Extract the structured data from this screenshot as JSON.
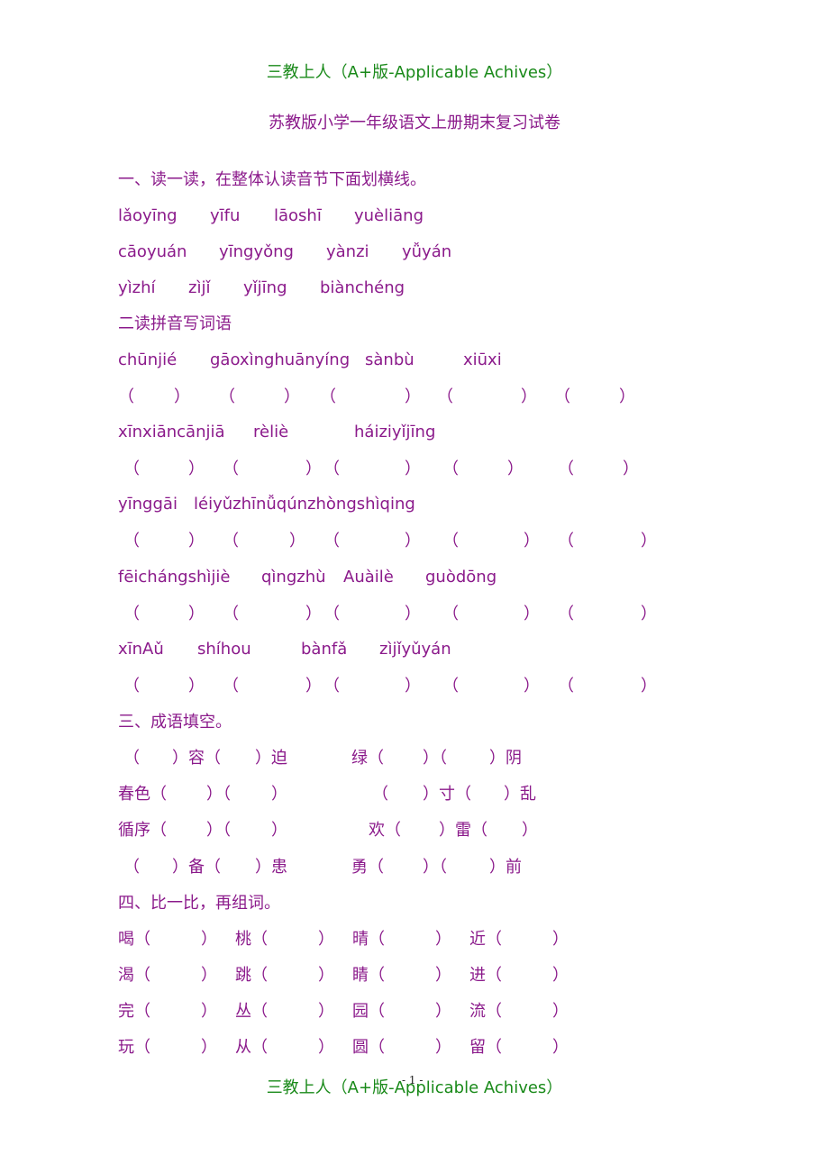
{
  "header": "三教上人（A+版-Applicable Achives）",
  "title": "苏教版小学一年级语文上册期末复习试卷",
  "section1": {
    "heading": "一、读一读，在整体认读音节下面划横线。",
    "rows": [
      [
        "lǎoyīng",
        "yīfu",
        "lāoshī",
        "yuèliāng"
      ],
      [
        "cāoyuán",
        "yīngyǒng",
        "yànzi",
        "yǚyán"
      ],
      [
        "yìzhí",
        "zìjǐ",
        "yǐjīng",
        "biànchéng"
      ]
    ]
  },
  "section2": {
    "heading": "二读拼音写词语",
    "pinyin_rows": [
      [
        "chūnjié",
        "gāoxìnghuānyíng",
        "sànbù",
        "xiūxi"
      ],
      [
        "xīnxiāncānjiā",
        "rèliè",
        "háiziyǐjīng"
      ],
      [
        "yīnggāi",
        "léiyǔzhīnǚqúnzhòngshìqing"
      ],
      [
        "fēichángshìjiè",
        "qìngzhù",
        "Auàilè",
        "guòdōng"
      ],
      [
        "xīnAǔ",
        "shíhou",
        "bànfǎ",
        "zìjǐyǔyán"
      ]
    ],
    "blank_open": "（",
    "blank_close": "）"
  },
  "section3": {
    "heading": "三、成语填空。",
    "rows": [
      [
        [
          "（",
          "）容（",
          "）迫"
        ],
        [
          "绿（",
          "）（",
          "）阴"
        ]
      ],
      [
        [
          "春色（",
          "）（",
          "）"
        ],
        [
          "（",
          "）寸（",
          "）乱"
        ]
      ],
      [
        [
          "循序（",
          "）（",
          "）"
        ],
        [
          "欢（",
          "）雷（",
          "）"
        ]
      ],
      [
        [
          "（",
          "）备（",
          "）患"
        ],
        [
          "勇（",
          "）（",
          "）前"
        ]
      ]
    ]
  },
  "section4": {
    "heading": "四、比一比，再组词。",
    "rows": [
      [
        "喝",
        "桃",
        "晴",
        "近"
      ],
      [
        "渴",
        "跳",
        "睛",
        "进"
      ],
      [
        "完",
        "丛",
        "园",
        "流"
      ],
      [
        "玩",
        "从",
        "圆",
        "留"
      ]
    ]
  },
  "footer": "三教上人（A+版-Applicable Achives）",
  "page_number": "- 1 -"
}
